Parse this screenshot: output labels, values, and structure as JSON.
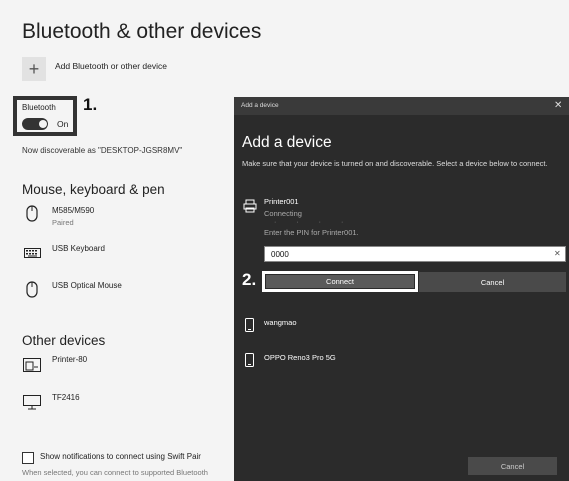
{
  "settings": {
    "title": "Bluetooth & other devices",
    "add_device_label": "Add Bluetooth or other device",
    "bluetooth_label": "Bluetooth",
    "toggle_state": "On",
    "step1_marker": "1.",
    "discoverable_text": "Now discoverable as \"DESKTOP-JGSR8MV\"",
    "section_mouse": "Mouse, keyboard & pen",
    "mouse_devices": [
      {
        "name": "M585/M590",
        "status": "Paired",
        "icon": "mouse-icon"
      },
      {
        "name": "USB Keyboard",
        "status": "",
        "icon": "keyboard-icon"
      },
      {
        "name": "USB Optical Mouse",
        "status": "",
        "icon": "mouse-icon"
      }
    ],
    "section_other": "Other devices",
    "other_devices": [
      {
        "name": "Printer-80",
        "icon": "printer-device-icon"
      },
      {
        "name": "TF2416",
        "icon": "monitor-icon"
      }
    ],
    "swift_pair_label": "Show notifications to connect using Swift Pair",
    "swift_pair_note": "When selected, you can connect to supported Bluetooth"
  },
  "dialog": {
    "bar_title": "Add a device",
    "close_glyph": "✕",
    "title": "Add a device",
    "description": "Make sure that your device is turned on and discoverable. Select a device below to connect.",
    "printer": {
      "name": "Printer001",
      "status": "Connecting",
      "pin_prompt": "Enter the PIN for Printer001."
    },
    "pin_value": "0000",
    "clear_glyph": "✕",
    "step2_marker": "2.",
    "connect_label": "Connect",
    "cancel_label": "Cancel",
    "devices": [
      {
        "name": "wangmao",
        "icon": "phone-icon"
      },
      {
        "name": "OPPO Reno3 Pro 5G",
        "icon": "phone-icon"
      }
    ],
    "bottom_cancel_label": "Cancel"
  }
}
